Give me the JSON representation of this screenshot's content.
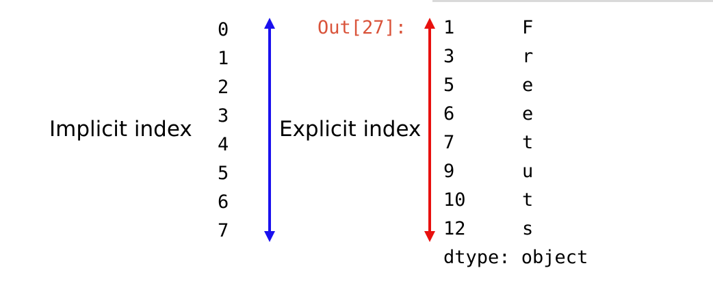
{
  "implicit_label": "Implicit index",
  "explicit_label": "Explicit index",
  "prompt": "Out[27]:",
  "implicit_index": [
    "0",
    "1",
    "2",
    "3",
    "4",
    "5",
    "6",
    "7"
  ],
  "explicit_index": [
    "1",
    "3",
    "5",
    "6",
    "7",
    "9",
    "10",
    "12"
  ],
  "values": [
    "F",
    "r",
    "e",
    "e",
    "t",
    "u",
    "t",
    "s"
  ],
  "dtype_line": "dtype: object",
  "colors": {
    "prompt": "#d9533a",
    "implicit_arrow": "#1a10ee",
    "explicit_arrow": "#e8100e"
  }
}
